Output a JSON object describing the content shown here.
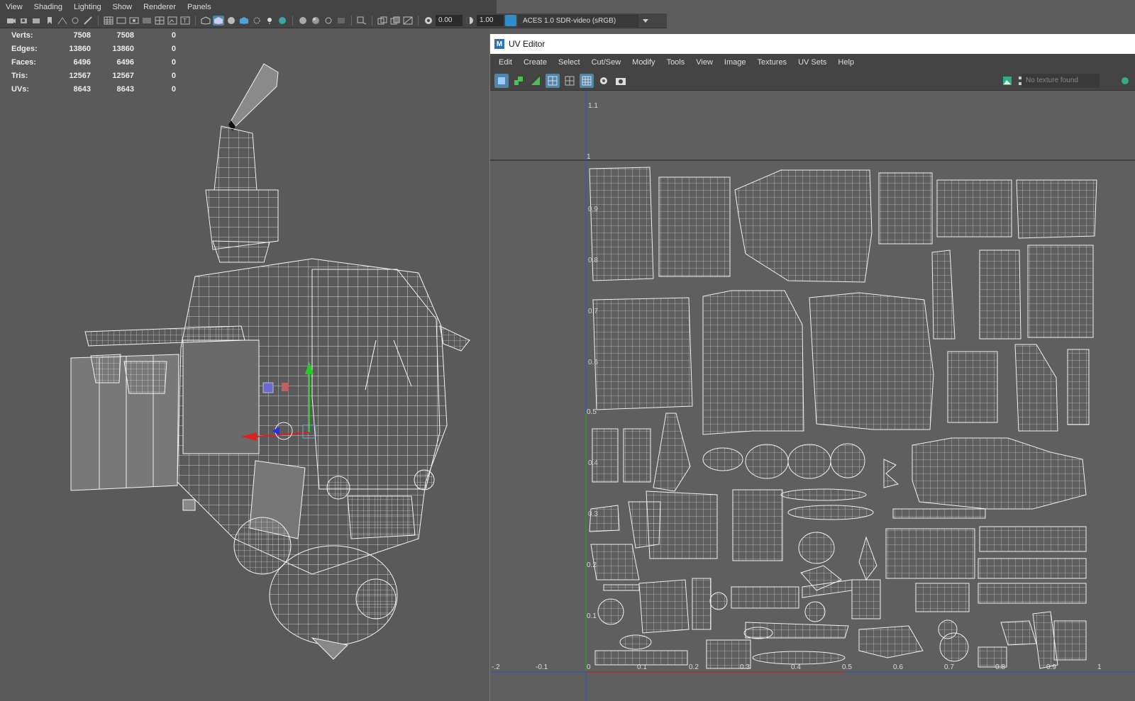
{
  "viewport_menu": [
    "View",
    "Shading",
    "Lighting",
    "Show",
    "Renderer",
    "Panels"
  ],
  "viewport_toolbar": {
    "exposure": "0.00",
    "gamma": "1.00",
    "color_space": "ACES 1.0 SDR-video (sRGB)"
  },
  "hud": {
    "rows": [
      {
        "label": "Verts:",
        "a": "7508",
        "b": "7508",
        "c": "0"
      },
      {
        "label": "Edges:",
        "a": "13860",
        "b": "13860",
        "c": "0"
      },
      {
        "label": "Faces:",
        "a": "6496",
        "b": "6496",
        "c": "0"
      },
      {
        "label": "Tris:",
        "a": "12567",
        "b": "12567",
        "c": "0"
      },
      {
        "label": "UVs:",
        "a": "8643",
        "b": "8643",
        "c": "0"
      }
    ]
  },
  "uv_editor": {
    "title": "UV Editor",
    "logo": "M",
    "menu": [
      "Edit",
      "Create",
      "Select",
      "Cut/Sew",
      "Modify",
      "Tools",
      "View",
      "Image",
      "Textures",
      "UV Sets",
      "Help"
    ],
    "texture_placeholder": "No texture found",
    "y_labels": [
      "1.1",
      "1",
      "0.9",
      "0.8",
      "0.7",
      "0.6",
      "0.5",
      "0.4",
      "0.3",
      "0.2",
      "0.1"
    ],
    "x_labels": [
      "-.2",
      "-0.1",
      "0",
      "0.1",
      "0.2",
      "0.3",
      "0.4",
      "0.5",
      "0.6",
      "0.7",
      "0.8",
      "0.9",
      "1"
    ]
  },
  "colors": {
    "wire": "#e8e8e8",
    "accent": "#5285a6",
    "axis_red": "#e02020",
    "axis_green": "#20d020",
    "axis_blue": "#2030ff"
  }
}
